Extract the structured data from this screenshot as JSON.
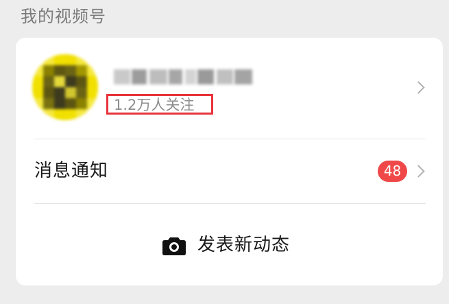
{
  "section_title": "我的视频号",
  "profile": {
    "followers": "1.2万人关注",
    "highlight_color": "#e8333a"
  },
  "notifications": {
    "label": "消息通知",
    "badge_count": "48",
    "badge_color": "#f04848"
  },
  "publish": {
    "label": "发表新动态",
    "icon": "camera-icon"
  },
  "icons": {
    "chevron": "chevron-right-icon"
  }
}
